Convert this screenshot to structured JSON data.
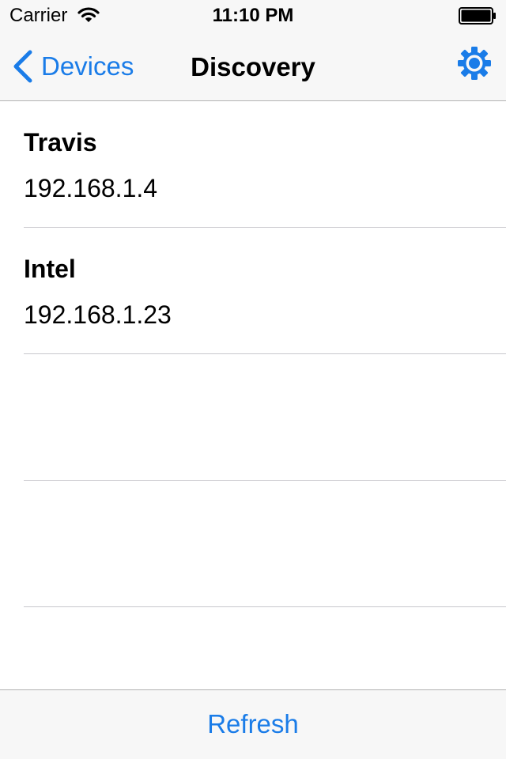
{
  "status_bar": {
    "carrier": "Carrier",
    "time": "11:10 PM",
    "wifi_icon": "wifi-icon",
    "battery_icon": "battery-icon"
  },
  "nav_bar": {
    "back_label": "Devices",
    "back_icon": "chevron-left-icon",
    "title": "Discovery",
    "settings_icon": "gear-icon"
  },
  "devices": [
    {
      "name": "Travis",
      "ip": "192.168.1.4"
    },
    {
      "name": "Intel",
      "ip": "192.168.1.23"
    }
  ],
  "toolbar": {
    "refresh_label": "Refresh"
  },
  "colors": {
    "accent": "#1a7ce8",
    "bar_background": "#f7f7f7",
    "separator": "#c8c7cc"
  }
}
